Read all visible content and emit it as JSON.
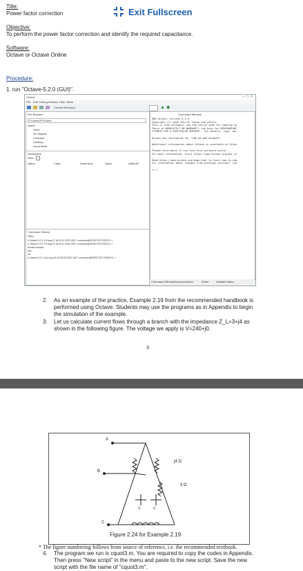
{
  "header": {
    "title_label": "Title:",
    "title_value": "Power factor correction",
    "exit_label": "Exit Fullscreen",
    "objective_label": "Objective:",
    "objective_value": "To perform the power factor correction and identify the required capacitance.",
    "software_label": "Software:",
    "software_value": "Octave or Octave Online",
    "procedure_label": "Procedure:",
    "step1": "1.  run \"Octave-5.2.0 (GUI)\"."
  },
  "octave": {
    "app_name": "Octave",
    "menu": [
      "File",
      "Edit",
      "Debug",
      "Window",
      "Help",
      "News"
    ],
    "current_directory_label": "Current Directory:",
    "file_browser_title": "File Browser",
    "path_value": "C:/Users/PY/Users",
    "name_header": "Name",
    "files": [
      "Links",
      "3D Objects",
      "Contacts",
      "Desktop",
      "Documents"
    ],
    "workspace_title": "Workspace",
    "filter_label": "Filter",
    "workspace_cols": [
      "Name",
      "Class",
      "Dimension",
      "Value",
      "Attribute"
    ],
    "history_title": "Command History",
    "history_lines": [
      "# Octave 5.2.0, Fri Aug 07 18:23:11 2020 GMT <unknown@DESKTOP-ER2073..>",
      "# Octave 5.2.0, Fri Aug 07 18:23:11 2020 GMT <unknown@DESKTOP-ER2073..>",
      "format compact",
      "test",
      "clc",
      "# Octave 5.2.0, Sun Aug 09 19:39:09 2020 GMT <unknown@DESKTOP-1R0D573..>"
    ],
    "command_window_title": "Command Window",
    "console_lines": [
      "GNU Octave, version 5.2.0",
      "Copyright (C) 2020 John W. Eaton and others.",
      "This is free software; see the source code for copying co",
      "There is ABSOLUTELY NO WARRANTY; not even for MERCHANTABI",
      "FITNESS FOR A PARTICULAR PURPOSE.  For details, type 'war",
      "",
      "Octave was configured for \"x86_64-w64-mingw32\".",
      "",
      "Additional information about Octave is available at https",
      "",
      "Please contribute if you find this software useful.",
      "For more information, visit https://www.octave.org/get-in",
      "",
      "Read https://www.octave.org/bugs.html to learn how to sub",
      "For information about changes from previous versions, typ",
      "",
      ">> |"
    ],
    "bottom_tabs": [
      "Command Window",
      "Documentation",
      "Editor",
      "Variable Editor"
    ]
  },
  "steps": {
    "step2_num": "2.",
    "step2_lines": [
      "As an example of the practice, Example 2.19 from the recommended handbook is",
      "performed using Octave. Students may use the programs as in Appendix to begin",
      "the simulation of the example."
    ],
    "step3_num": "3.",
    "step3_lines": [
      "Let us calculate current flows through a branch with the impedance Z_L=3+j4 as",
      "shown in the following figure. The voltage we apply is V=240+j0."
    ],
    "page_number": "3"
  },
  "figure": {
    "label_a": "A",
    "label_b": "B",
    "label_c": "C",
    "label_cap1": "C",
    "label_cap2": "C",
    "label_r4": "j4 Ω",
    "label_r3": "3 Ω",
    "caption": "Figure 2.24 for Example 2.19"
  },
  "footnote": "The figure numbering follows from source of reference, i.e. the recommended textbook.",
  "step4": {
    "num": "4.",
    "lines": [
      "The program we run is cquot3.m. You are required to copy the codes in Appendix.",
      "Then press \"New script\" in the menu and paste to the new script. Save the new",
      "script with the file name of \"cquot3.m\"."
    ]
  }
}
